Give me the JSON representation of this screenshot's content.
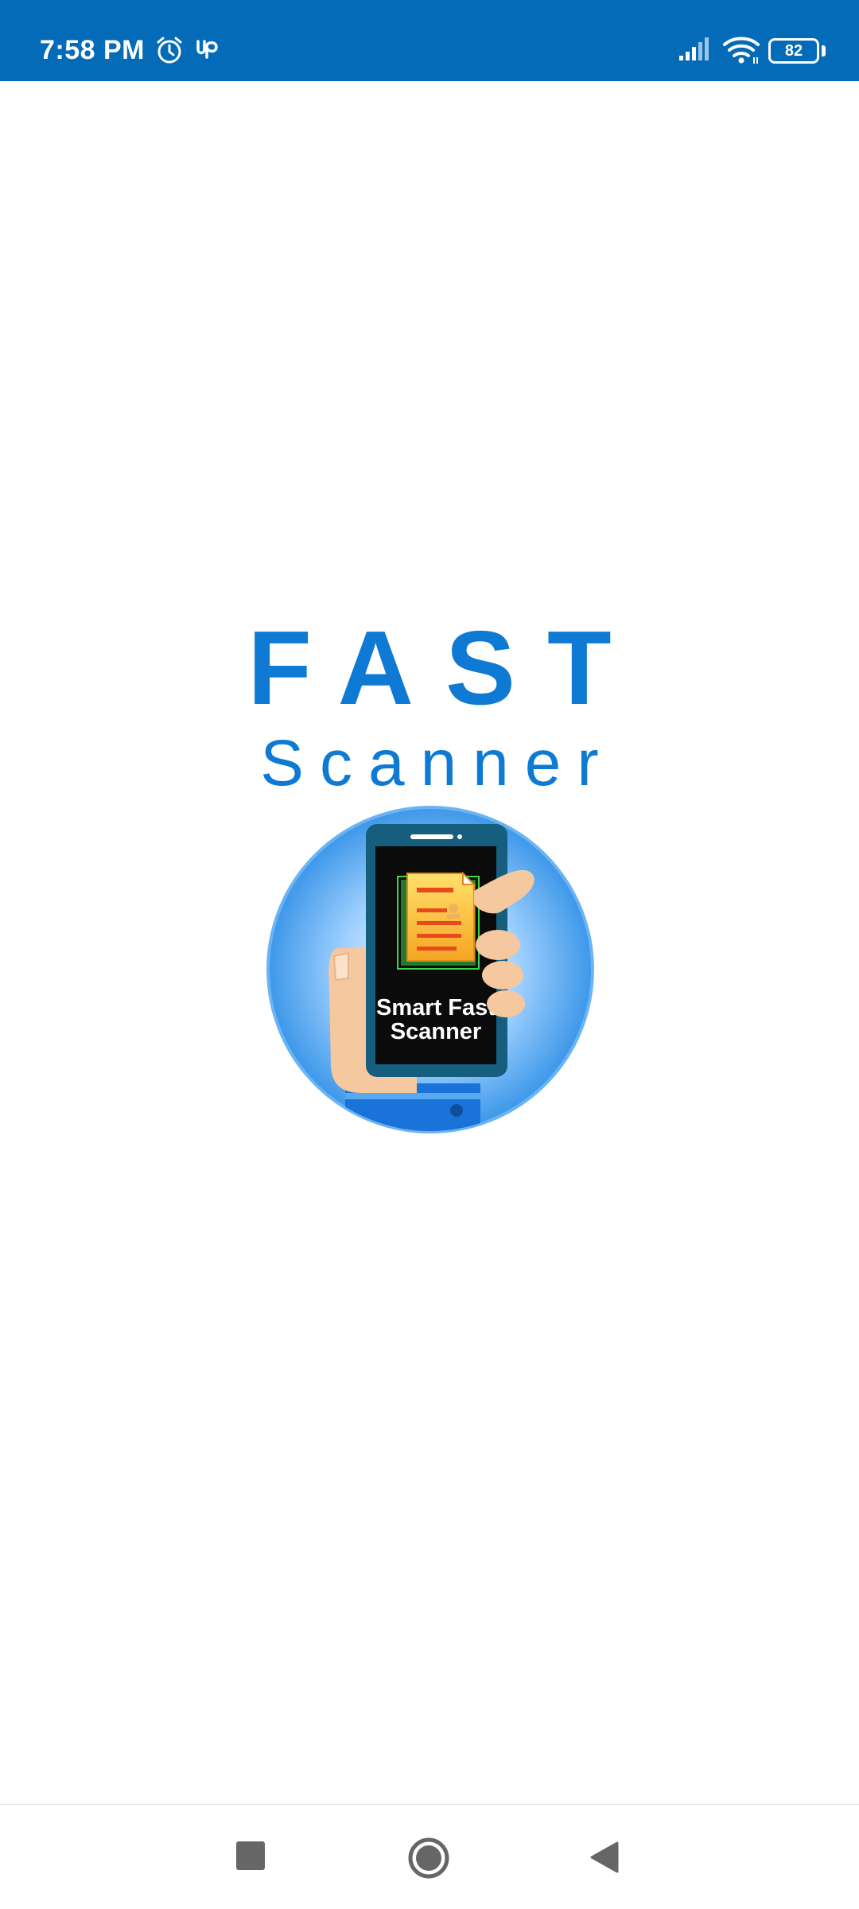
{
  "status_bar": {
    "time": "7:58 PM",
    "background_color": "#036bb7",
    "icons": [
      "alarm-icon",
      "upwork-icon",
      "signal-icon",
      "wifi-icon",
      "battery-icon"
    ],
    "battery_level": "82"
  },
  "splash": {
    "title": "FAST",
    "subtitle": "Scanner",
    "accent_color": "#0f7ad3",
    "logo": {
      "label_line1": "Smart Fast",
      "label_line2": "Scanner"
    }
  },
  "nav_bar": {
    "buttons": [
      "recents-button",
      "home-button",
      "back-button"
    ]
  }
}
